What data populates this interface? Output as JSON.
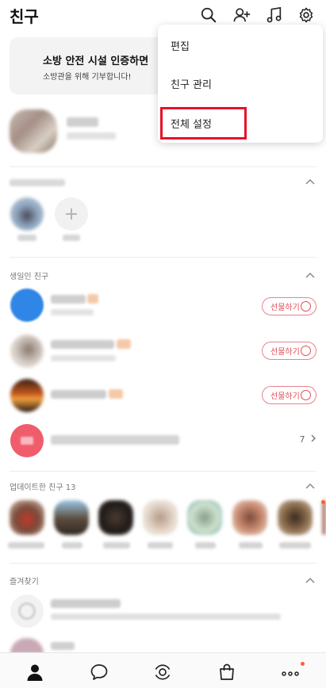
{
  "header": {
    "title": "친구"
  },
  "banner": {
    "title": "소방 안전 시설 인증하면",
    "subtitle": "소방관을 위해 기부합니다!"
  },
  "dropdown": {
    "items": [
      "편집",
      "친구 관리",
      "전체 설정"
    ],
    "highlighted": "전체 설정"
  },
  "sections": {
    "birthday": {
      "title": "생일인 친구",
      "gift_label": "선물하기",
      "more_count": "7"
    },
    "updated": {
      "title": "업데이트한 친구 13"
    },
    "favorites": {
      "title": "즐겨찾기"
    }
  },
  "tabs": [
    "friends",
    "chats",
    "view",
    "shopping",
    "more"
  ],
  "colors": {
    "accent": "#e34b57",
    "highlight_box": "#e8112a",
    "notification_dot": "#ff5b3a"
  },
  "icons": {
    "header": [
      "search-icon",
      "add-friend-icon",
      "music-icon",
      "settings-gear-icon"
    ],
    "tabbar": [
      "person-icon",
      "chat-bubble-icon",
      "view-icon",
      "shopping-bag-icon",
      "more-dots-icon"
    ]
  }
}
